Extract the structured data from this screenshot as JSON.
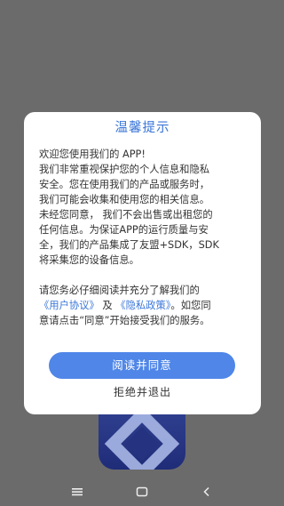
{
  "app": {
    "logo_icon": "app-logo-icon"
  },
  "dialog": {
    "title": "温馨提示",
    "paragraph1": {
      "line1": "欢迎您使用我们的 APP!",
      "line2": "我们非常重视保护您的个人信息和隐私",
      "line3": "安全。您在使用我们的产品或服务时，",
      "line4": "我们可能会收集和使用您的相关信息。",
      "line5": "未经您同意， 我们不会出售或出租您的",
      "line6": "任何信息。为保证APP的运行质量与安",
      "line7": "全，我们的产品集成了友盟+SDK，SDK",
      "line8": "将采集您的设备信息。"
    },
    "paragraph2": {
      "line1": "请您务必仔细阅读并充分了解我们的",
      "user_agreement_link": "《用户协议》",
      "and": " 及 ",
      "privacy_policy_link": "《隐私政策》",
      "line2_rest": "。如您同",
      "line3": "意请点击“同意”开始接受我们的服务。"
    },
    "agree_button": "阅读并同意",
    "exit_button": "拒绝并退出"
  },
  "nav": {
    "menu_icon": "menu-icon",
    "home_icon": "home-icon",
    "back_icon": "back-icon"
  },
  "colors": {
    "accent": "#3a76d8",
    "button": "#4f86e8",
    "overlay": "#6b6b6b"
  }
}
